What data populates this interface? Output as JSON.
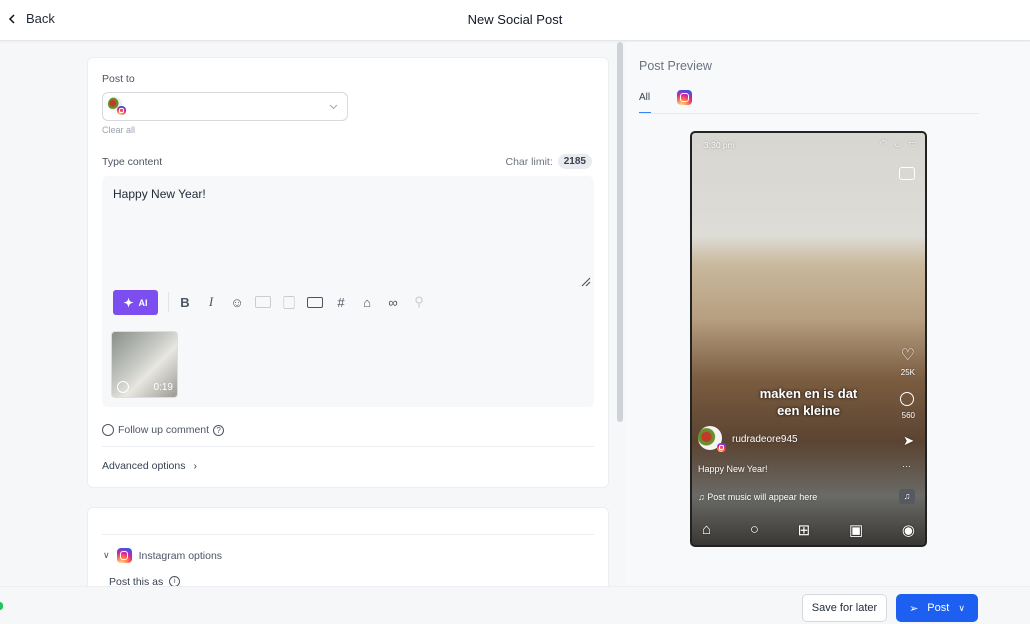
{
  "header": {
    "back_label": "Back",
    "title": "New Social Post"
  },
  "compose": {
    "post_to_label": "Post to",
    "clear_all": "Clear all",
    "type_content_label": "Type content",
    "char_limit_label": "Char limit:",
    "char_limit_value": "2185",
    "content": "Happy New Year!",
    "ai_label": "AI",
    "video_duration": "0:19",
    "follow_up_label": "Follow up comment",
    "advanced_label": "Advanced options"
  },
  "instagram_options": {
    "label": "Instagram options",
    "post_this_as": "Post this as"
  },
  "preview": {
    "title": "Post Preview",
    "tab_all": "All",
    "time": "3:30 pm",
    "caption_overlay_1": "maken en is dat",
    "caption_overlay_2": "een kleine",
    "likes": "25K",
    "comments": "560",
    "username": "rudradeore945",
    "caption": "Happy New Year!",
    "music": "Post music will appear here"
  },
  "footer": {
    "save_label": "Save for later",
    "post_label": "Post"
  },
  "colors": {
    "accent": "#1d5ff0",
    "ai": "#7c4ef0"
  }
}
